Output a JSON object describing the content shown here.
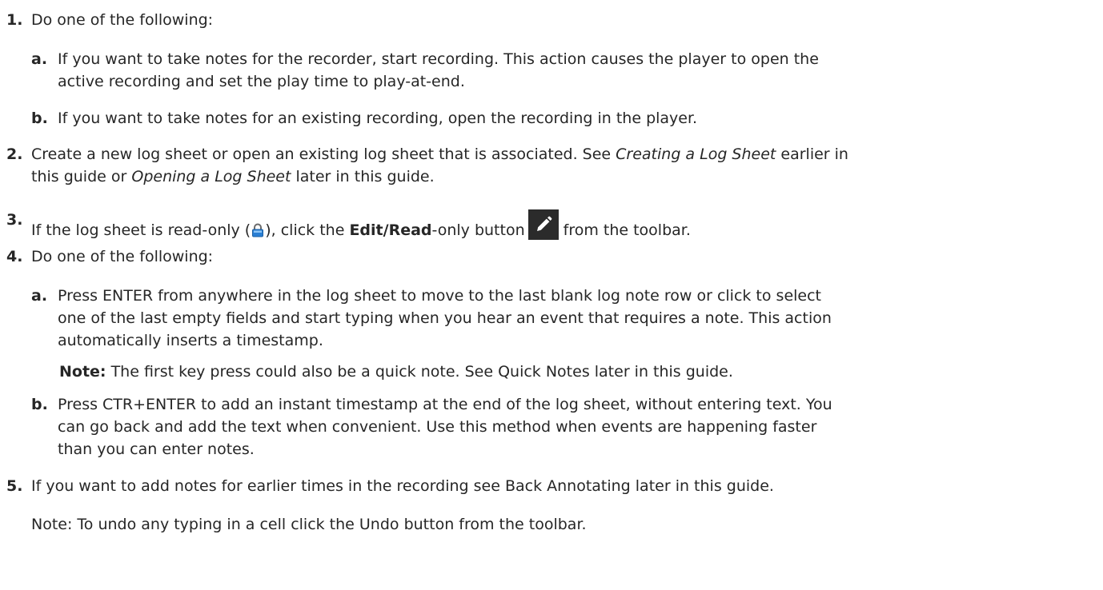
{
  "steps": [
    {
      "num": "1.",
      "text": "Do one of the following:",
      "sub": [
        {
          "letter": "a.",
          "line1": "If you want to take notes for the recorder, start recording.  This action causes the player to open the",
          "line2": "active recording and set the play time to play-at-end."
        },
        {
          "letter": "b.",
          "line1": "If you want to take notes for an existing recording, open the recording in the player."
        }
      ]
    },
    {
      "num": "2.",
      "line1_a": "Create a new log sheet or open an existing log sheet that is associated.  See ",
      "line1_ref": "Creating a Log Sheet",
      "line1_b": " earlier in",
      "line2_a": "this guide or ",
      "line2_ref": "Opening a Log Sheet",
      "line2_b": " later in this guide."
    },
    {
      "num": "3.",
      "t1": "If the log sheet is read-only (",
      "t2": "), click the ",
      "bold1": "Edit/Read",
      "t3": "-only button",
      "t4": "from the toolbar."
    },
    {
      "num": "4.",
      "text": "Do one of the following:",
      "sub": [
        {
          "letter": "a.",
          "line1": "Press ENTER from anywhere in the log sheet to move to the last blank log note row or click to select",
          "line2": "one of the last empty fields and start typing when you hear an event that requires a note.  This action",
          "line3": "automatically inserts a timestamp.",
          "note_label": "Note:",
          "note_text": "  The first key press could also be a quick note.  See Quick Notes later in this guide."
        },
        {
          "letter": "b.",
          "line1": "Press CTR+ENTER to add an instant timestamp at the end of the log sheet, without entering text.  You",
          "line2": "can go back and add the text when convenient.  Use this method when events are happening faster",
          "line3": "than you can enter notes."
        }
      ]
    },
    {
      "num": "5.",
      "text": "If you want to add notes for earlier times in the recording see Back Annotating later in this guide.",
      "note": "Note:  To undo any typing in a cell click the Undo button from the toolbar."
    }
  ],
  "icons": {
    "lock": "lock-icon",
    "edit": "pencil-icon"
  },
  "colors": {
    "text": "#262626",
    "lock_blue": "#2a7fd4",
    "button_bg": "#2b2b2b"
  }
}
